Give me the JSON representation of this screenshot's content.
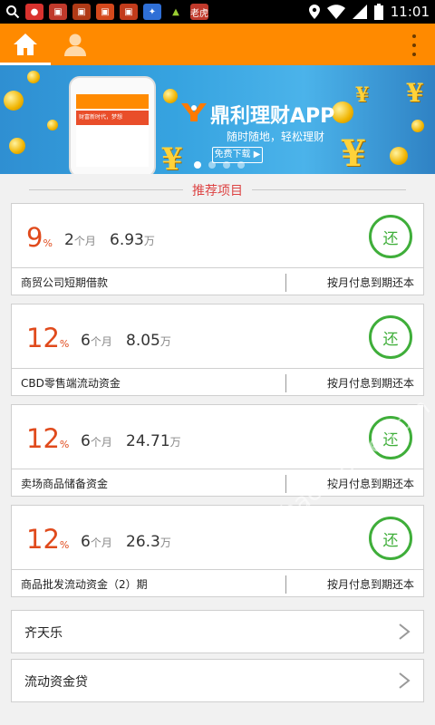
{
  "status_bar": {
    "time": "11:01",
    "notification_icons": [
      "search-icon",
      "wechat-icon",
      "app-icon-1",
      "app-icon-2",
      "app-icon-3",
      "app-icon-4",
      "baidu-icon",
      "android-icon",
      "app-icon-5"
    ],
    "status_icons": [
      "location-icon",
      "wifi-icon",
      "signal-icon",
      "battery-icon"
    ],
    "app_icon_5_text": "老虎"
  },
  "topbar": {
    "tabs": [
      "home-icon",
      "user-icon"
    ],
    "menu": "overflow-menu-icon"
  },
  "banner": {
    "brand_title": "鼎利理财APP",
    "subtitle": "随时随地，轻松理财",
    "download_label": "免费下载 ▶",
    "phone_ad_text": "财富新时代，梦想"
  },
  "section": {
    "title": "推荐项目"
  },
  "projects": [
    {
      "rate": "9",
      "rate_unit": "%",
      "term": "2",
      "term_unit": "个月",
      "amount": "6.93",
      "amount_unit": "万",
      "status": "还",
      "name": "商贸公司短期借款",
      "repayment": "按月付息到期还本"
    },
    {
      "rate": "12",
      "rate_unit": "%",
      "term": "6",
      "term_unit": "个月",
      "amount": "8.05",
      "amount_unit": "万",
      "status": "还",
      "name": "CBD零售端流动资金",
      "repayment": "按月付息到期还本"
    },
    {
      "rate": "12",
      "rate_unit": "%",
      "term": "6",
      "term_unit": "个月",
      "amount": "24.71",
      "amount_unit": "万",
      "status": "还",
      "name": "卖场商品储备资金",
      "repayment": "按月付息到期还本"
    },
    {
      "rate": "12",
      "rate_unit": "%",
      "term": "6",
      "term_unit": "个月",
      "amount": "26.3",
      "amount_unit": "万",
      "status": "还",
      "name": "商品批发流动资金（2）期",
      "repayment": "按月付息到期还本"
    }
  ],
  "list_items": [
    {
      "label": "齐天乐"
    },
    {
      "label": "流动资金贷"
    }
  ],
  "watermark": "www.hackhome.com",
  "colors": {
    "accent": "#ff8a00",
    "rate": "#e04a1c",
    "status_green": "#3fae3a",
    "section_title": "#dd4444"
  }
}
